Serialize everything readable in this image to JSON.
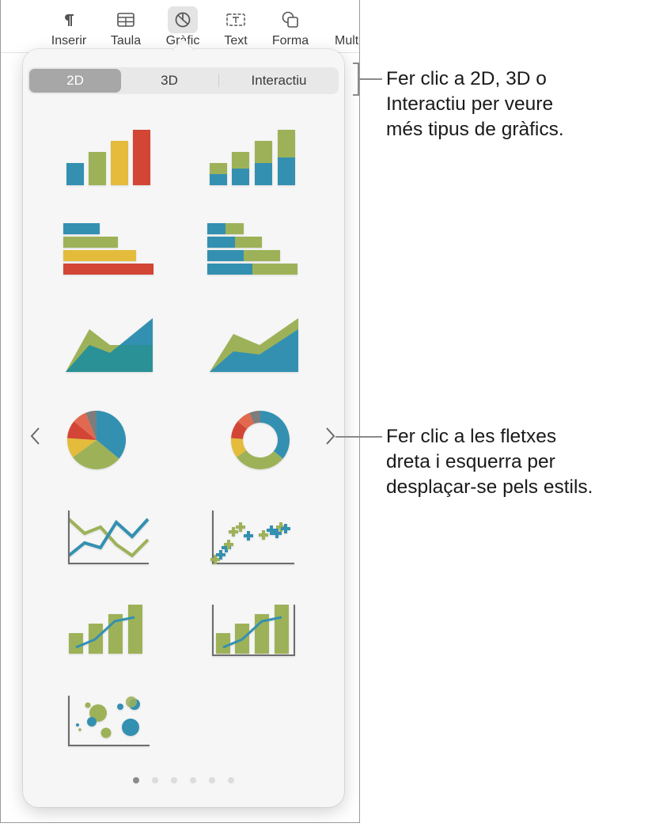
{
  "toolbar": {
    "items": [
      {
        "label": "Inserir",
        "icon": "paragraph-icon",
        "active": false
      },
      {
        "label": "Taula",
        "icon": "table-icon",
        "active": false
      },
      {
        "label": "Gràfic",
        "icon": "chart-icon",
        "active": true
      },
      {
        "label": "Text",
        "icon": "text-box-icon",
        "active": false
      },
      {
        "label": "Forma",
        "icon": "shape-icon",
        "active": false
      },
      {
        "label": "Mult",
        "icon": "media-icon",
        "active": false
      }
    ]
  },
  "chart_picker": {
    "segments": [
      {
        "label": "2D",
        "selected": true
      },
      {
        "label": "3D",
        "selected": false
      },
      {
        "label": "Interactiu",
        "selected": false
      }
    ],
    "chart_types": [
      "column",
      "stacked-column",
      "bar",
      "stacked-bar",
      "area",
      "stacked-area",
      "pie",
      "donut",
      "line",
      "scatter",
      "mixed",
      "two-axis",
      "bubble"
    ],
    "page_count": 6,
    "current_page": 1,
    "colors": {
      "blue": "#3390b1",
      "green": "#9db258",
      "yellow": "#e4bb3b",
      "red": "#d34535",
      "salmon": "#e0694f",
      "gray": "#7d7d7d",
      "teal": "#2a9196"
    }
  },
  "callouts": {
    "segments_hint": [
      "Fer clic a 2D, 3D o",
      "Interactiu per veure",
      "més tipus de gràfics."
    ],
    "arrows_hint": [
      "Fer clic a les fletxes",
      "dreta i esquerra per",
      "desplaçar-se pels estils."
    ]
  }
}
